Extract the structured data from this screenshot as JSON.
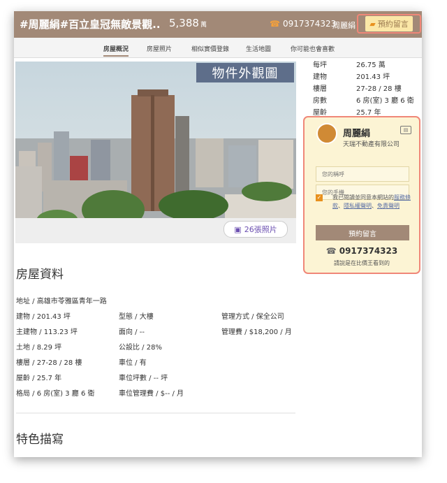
{
  "header": {
    "title": "#周麗絹#百立皇冠無敵景觀...",
    "price": "5,388",
    "price_unit": "萬",
    "phone": "0917374323",
    "agent": "周麗絹",
    "reserve_label": "預約留言"
  },
  "tabs": [
    "房屋概況",
    "房屋照片",
    "相似實價登錄",
    "生活地圖",
    "你可能也會喜歡"
  ],
  "photo": {
    "watermark": "物件外觀圖",
    "count_label": "26張照片"
  },
  "specs": [
    {
      "k": "每坪",
      "v": "26.75 萬"
    },
    {
      "k": "建物",
      "v": "201.43 坪"
    },
    {
      "k": "樓層",
      "v": "27-28 / 28 樓"
    },
    {
      "k": "房數",
      "v": "6 房(室) 3 廳 6 衛"
    },
    {
      "k": "屋齡",
      "v": "25.7 年"
    }
  ],
  "card": {
    "name": "周麗絹",
    "company": "天瑞不動產有限公司",
    "name_placeholder": "您的稱呼",
    "phone_placeholder": "您的手機",
    "agree_prefix": "我已閱讀並同意本網站的",
    "agree_link1": "服務條款",
    "agree_sep1": "、",
    "agree_link2": "隱私權聲明",
    "agree_sep2": "、",
    "agree_link3": "免責聲明",
    "submit": "預約留言",
    "phone": "0917374323",
    "tip": "請說是在比價王看到的"
  },
  "info": {
    "heading": "房屋資料",
    "address": "地址 / 高雄市苓雅區青年一路",
    "rows": [
      [
        "建物 / 201.43 坪",
        "型態 / 大樓",
        "管理方式 / 保全公司"
      ],
      [
        "主建物 / 113.23 坪",
        "面向 / --",
        "管理費 / $18,200 / 月"
      ],
      [
        "土地 / 8.29 坪",
        "公設比 / 28%",
        ""
      ],
      [
        "樓層 / 27-28 / 28 樓",
        "車位 / 有",
        ""
      ],
      [
        "屋齡 / 25.7 年",
        "車位坪數 / -- 坪",
        ""
      ],
      [
        "格局 / 6 房(室) 3 廳 6 衛",
        "車位管理費 / $-- / 月",
        ""
      ]
    ]
  },
  "feature": {
    "heading": "特色描寫"
  }
}
